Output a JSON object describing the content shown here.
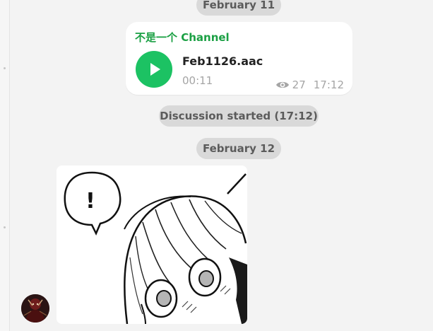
{
  "date_pills": {
    "feb11": "February 11",
    "discussion": "Discussion started (17:12)",
    "feb12": "February 12"
  },
  "audio_message": {
    "channel_name": "不是一个 Channel",
    "file_name": "Feb1126.aac",
    "duration": "00:11",
    "views": "27",
    "time": "17:12",
    "play_icon": "play-icon",
    "views_icon": "eye-icon"
  },
  "image_message": {
    "image": "manga-girl-surprised-sticker",
    "exclamation": "!"
  },
  "colors": {
    "channel_name": "#1ba044",
    "play_button": "#1cc263",
    "pill_bg": "#d9d9d9",
    "meta_text": "#a5a5a5"
  }
}
